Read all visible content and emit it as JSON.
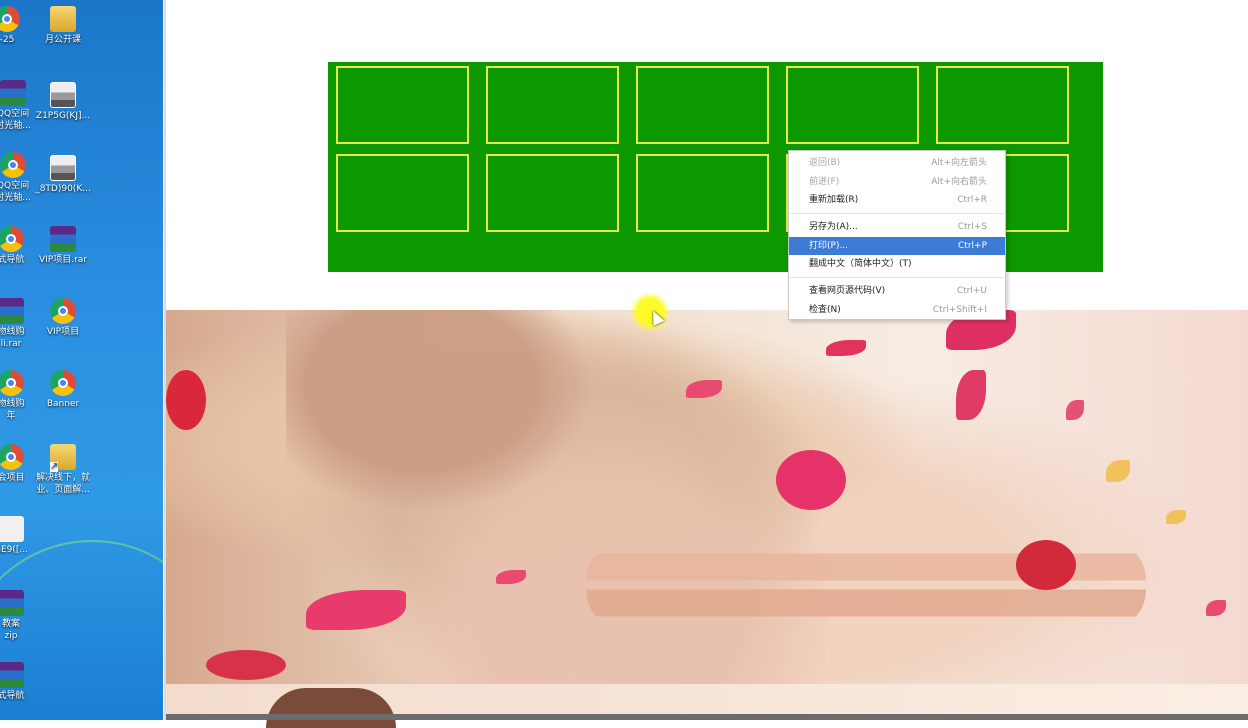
{
  "desktop": {
    "icons": [
      {
        "label": "-25",
        "type": "chrome"
      },
      {
        "label": "月公开课",
        "type": "folder"
      },
      {
        "label": "QQ空间\n时光轴...",
        "type": "rar"
      },
      {
        "label": "Z1P5G(KJ]...",
        "type": "photo"
      },
      {
        "label": "QQ空间\n时光轴...",
        "type": "chrome"
      },
      {
        "label": "_8TD)90(K...",
        "type": "photo"
      },
      {
        "label": "式导航",
        "type": "chrome"
      },
      {
        "label": "VIP项目.rar",
        "type": "rar"
      },
      {
        "label": "物线购\nli.rar",
        "type": "rar"
      },
      {
        "label": "VIP项目",
        "type": "chrome"
      },
      {
        "label": "物线购\n年",
        "type": "chrome"
      },
      {
        "label": "Banner",
        "type": "chrome"
      },
      {
        "label": "会项目",
        "type": "chrome"
      },
      {
        "label": "解决线下，就\n业、页面解...",
        "type": "shortcut"
      },
      {
        "label": "GE9([...",
        "type": "blank"
      },
      {
        "label": "教案\nzip",
        "type": "rar"
      },
      {
        "label": "式导航",
        "type": "rar"
      }
    ]
  },
  "context_menu": {
    "items": [
      {
        "label": "返回(B)",
        "shortcut": "Alt+向左箭头",
        "state": "disabled"
      },
      {
        "label": "前进(F)",
        "shortcut": "Alt+向右箭头",
        "state": "disabled"
      },
      {
        "label": "重新加载(R)",
        "shortcut": "Ctrl+R",
        "state": "normal"
      },
      {
        "label": "另存为(A)...",
        "shortcut": "Ctrl+S",
        "state": "normal"
      },
      {
        "label": "打印(P)...",
        "shortcut": "Ctrl+P",
        "state": "active"
      },
      {
        "label": "翻成中文（简体中文）(T)",
        "shortcut": "",
        "state": "normal"
      },
      {
        "label": "查看网页源代码(V)",
        "shortcut": "Ctrl+U",
        "state": "normal"
      },
      {
        "label": "检查(N)",
        "shortcut": "Ctrl+Shift+I",
        "state": "normal"
      }
    ]
  },
  "colors": {
    "green_box": "#0c9800",
    "cell_border": "#e8e84a",
    "menu_highlight": "#3d7bd7",
    "desktop_blue": "#2a8ee0"
  }
}
